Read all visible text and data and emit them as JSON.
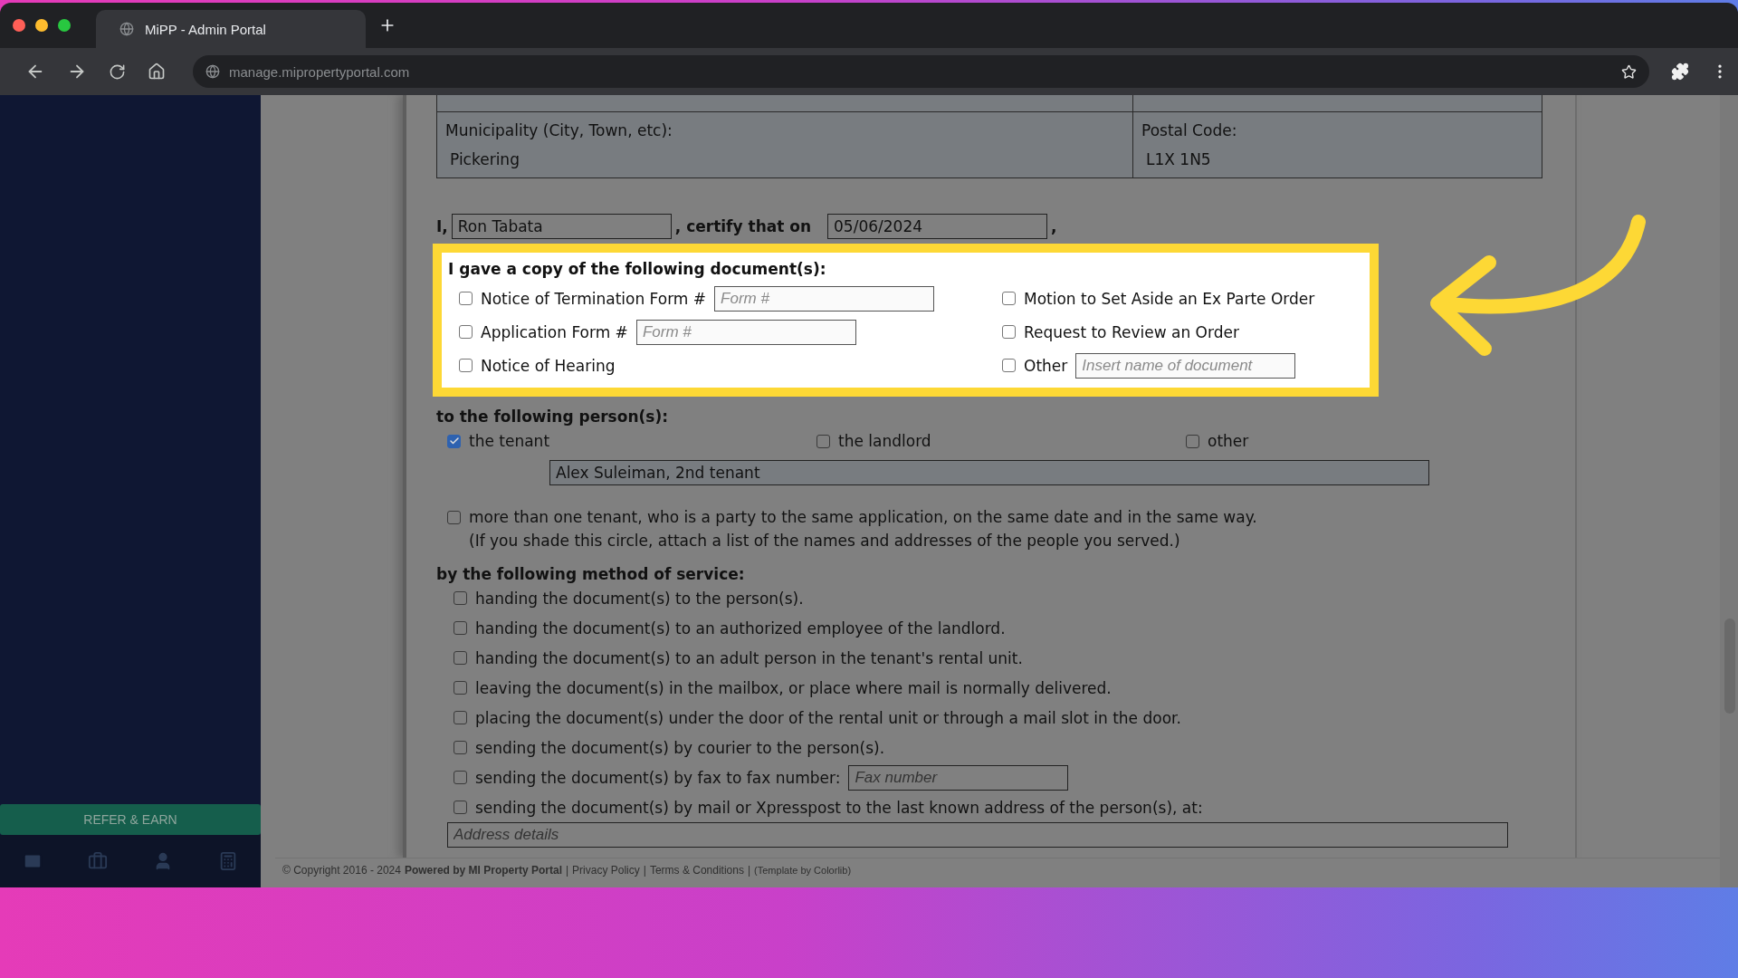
{
  "browser": {
    "tab_title": "MiPP - Admin Portal",
    "url": "manage.mipropertyportal.com"
  },
  "sidebar": {
    "refer_button": "REFER & EARN"
  },
  "address_table": {
    "cells": [
      {
        "label": "Municipality (City, Town, etc):",
        "value": "Pickering"
      },
      {
        "label": "Postal Code:",
        "value": "L1X 1N5"
      }
    ]
  },
  "certification": {
    "prefix": "I,",
    "name": "Ron Tabata",
    "middle": ", certify that on",
    "date": "05/06/2024",
    "suffix": ","
  },
  "documents": {
    "heading": "I gave a copy of the following document(s):",
    "left": [
      {
        "label": "Notice of Termination Form #",
        "checked": false,
        "placeholder": "Form #"
      },
      {
        "label": "Application Form #",
        "checked": false,
        "placeholder": "Form #"
      },
      {
        "label": "Notice of Hearing",
        "checked": false
      }
    ],
    "right": [
      {
        "label": "Motion to Set Aside an Ex Parte Order",
        "checked": false
      },
      {
        "label": "Request to Review an Order",
        "checked": false
      },
      {
        "label": "Other",
        "checked": false,
        "placeholder": "Insert name of document"
      }
    ]
  },
  "persons": {
    "heading": "to the following person(s):",
    "options": [
      {
        "label": "the tenant",
        "checked": true
      },
      {
        "label": "the landlord",
        "checked": false
      },
      {
        "label": "other",
        "checked": false
      }
    ],
    "name_value": "Alex Suleiman, 2nd  tenant"
  },
  "multiple": {
    "checked": false,
    "text": "more than one tenant, who is a party to the same application, on the same date and in the same way.",
    "note": "(If you shade this circle, attach a list of the names and addresses of the people you served.)"
  },
  "service": {
    "heading": "by the following method of service:",
    "methods": [
      {
        "label": "handing the document(s) to the person(s).",
        "checked": false
      },
      {
        "label": "handing the document(s) to an authorized employee of the landlord.",
        "checked": false
      },
      {
        "label": "handing the document(s) to an adult person in the tenant's rental unit.",
        "checked": false
      },
      {
        "label": "leaving the document(s) in the mailbox, or place where mail is normally delivered.",
        "checked": false
      },
      {
        "label": "placing the document(s) under the door of the rental unit or through a mail slot in the door.",
        "checked": false
      },
      {
        "label": "sending the document(s) by courier to the person(s).",
        "checked": false
      },
      {
        "label": "sending the document(s) by fax to fax number:",
        "checked": false,
        "placeholder": "Fax number"
      },
      {
        "label": "sending the document(s) by mail or Xpresspost to the last known address of the person(s), at:",
        "checked": false
      }
    ],
    "address_placeholder": "Address details"
  },
  "footer": [
    {
      "kind": "text",
      "text": "© Copyright 2016 - 2024"
    },
    {
      "kind": "strong",
      "text": "Powered by MI Property Portal"
    },
    {
      "kind": "sep",
      "text": "|"
    },
    {
      "kind": "link",
      "text": "Privacy Policy"
    },
    {
      "kind": "sep",
      "text": "|"
    },
    {
      "kind": "link",
      "text": "Terms & Conditions"
    },
    {
      "kind": "sep",
      "text": "|"
    },
    {
      "kind": "small",
      "text": "(Template by Colorlib)"
    }
  ]
}
